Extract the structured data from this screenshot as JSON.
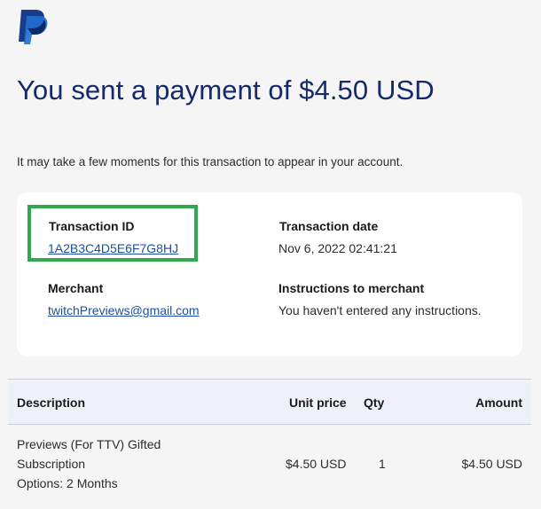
{
  "header": {
    "logo_icon": "paypal-logo",
    "headline": "You sent a payment of $4.50 USD",
    "note": "It may take a few moments for this transaction to appear in your account."
  },
  "details": {
    "transaction_id_label": "Transaction ID",
    "transaction_id_value": "1A2B3C4D5E6F7G8HJ",
    "transaction_date_label": "Transaction date",
    "transaction_date_value": "Nov 6, 2022 02:41:21",
    "merchant_label": "Merchant",
    "merchant_value": "twitchPreviews@gmail.com",
    "instructions_label": "Instructions to merchant",
    "instructions_value": "You haven't entered any instructions."
  },
  "table": {
    "headers": {
      "description": "Description",
      "unit_price": "Unit price",
      "qty": "Qty",
      "amount": "Amount"
    },
    "rows": [
      {
        "description_line1": "Previews (For TTV) Gifted",
        "description_line2": "Subscription",
        "description_line3": "Options: 2 Months",
        "unit_price": "$4.50 USD",
        "qty": "1",
        "amount": "$4.50 USD"
      }
    ]
  },
  "colors": {
    "headline": "#152a6b",
    "link": "#1d4f9c",
    "highlight_box": "#2fa84f",
    "logo_dark": "#1a3a8a",
    "logo_light": "#1f6fd0"
  }
}
